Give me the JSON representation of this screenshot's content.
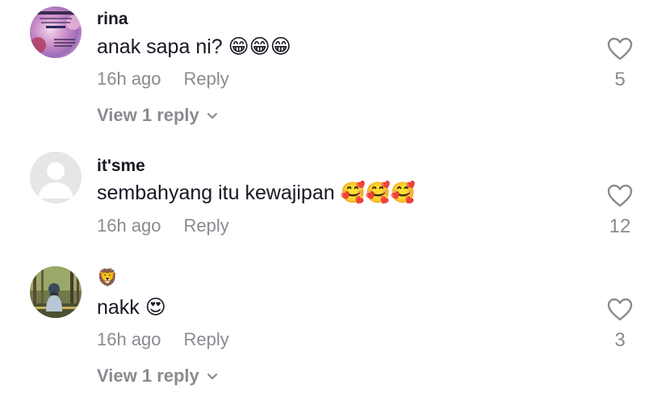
{
  "comments": [
    {
      "username": "rina",
      "text": "anak sapa ni? 😁😁😁",
      "time": "16h ago",
      "reply_label": "Reply",
      "likes": "5",
      "view_replies": "View 1 reply",
      "avatar_text": "ALLAHUMMASSALLI Alhamdulillah"
    },
    {
      "username": "it'sme",
      "text": "sembahyang itu kewajipan 🥰🥰🥰",
      "time": "16h ago",
      "reply_label": "Reply",
      "likes": "12"
    },
    {
      "username": "🦁",
      "text": "nakk 😍",
      "time": "16h ago",
      "reply_label": "Reply",
      "likes": "3",
      "view_replies": "View 1 reply"
    }
  ],
  "colors": {
    "text_primary": "#161823",
    "text_secondary": "#8a8b91",
    "background": "#ffffff"
  }
}
